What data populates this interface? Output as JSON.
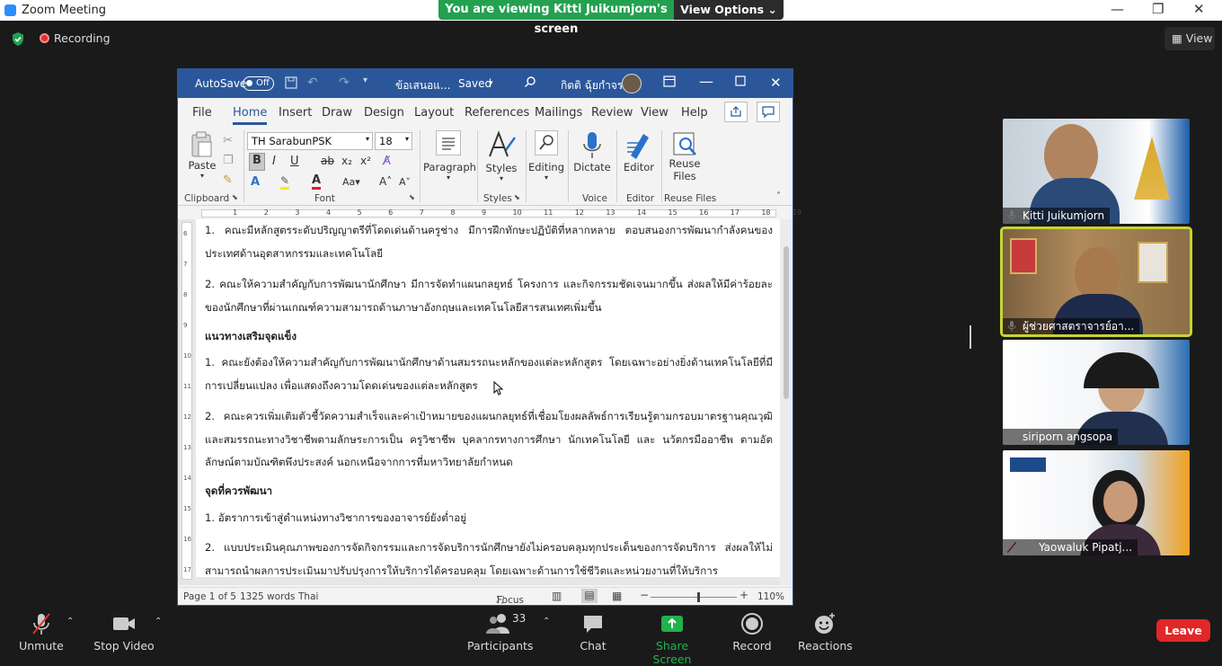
{
  "zoom": {
    "window_title": "Zoom Meeting",
    "viewing_banner": "You are viewing Kitti Juikumjorn's screen",
    "view_options_label": "View Options",
    "recording_label": "Recording",
    "view_button_label": "View",
    "window_controls": {
      "minimize": "—",
      "restore": "❐",
      "close": "✕"
    }
  },
  "word": {
    "autosave_label": "AutoSave",
    "autosave_state": "Off",
    "doc_title": "ข้อเสนอแ...",
    "saved_label": "Saved",
    "user_name": "กิตติ ฉุ้ยกำจร",
    "tabs": [
      "File",
      "Home",
      "Insert",
      "Draw",
      "Design",
      "Layout",
      "References",
      "Mailings",
      "Review",
      "View",
      "Help"
    ],
    "ribbon": {
      "paste_label": "Paste",
      "clipboard_label": "Clipboard",
      "font_name": "TH SarabunPSK",
      "font_size": "18",
      "font_label": "Font",
      "paragraph_label": "Paragraph",
      "styles_button": "Styles",
      "styles_label": "Styles",
      "editing_label": "Editing",
      "dictate_label": "Dictate",
      "voice_label": "Voice",
      "editor_button": "Editor",
      "editor_label": "Editor",
      "reuse_files_line1": "Reuse",
      "reuse_files_line2": "Files",
      "reuse_files_group": "Reuse Files"
    },
    "paragraphs": [
      {
        "type": "text",
        "text": "1. คณะมีหลักสูตรระดับปริญญาตรีที่โดดเด่นด้านครูช่าง มีการฝึกทักษะปฏิบัติที่หลากหลาย ตอบสนองการพัฒนากำลังคนของประเทศด้านอุตสาหกรรมและเทคโนโลยี"
      },
      {
        "type": "text",
        "text": "2. คณะให้ความสำคัญกับการพัฒนานักศึกษา มีการจัดทำแผนกลยุทธ์ โครงการ และกิจกรรมชัดเจนมากขึ้น ส่งผลให้มีค่าร้อยละของนักศึกษาที่ผ่านเกณฑ์ความสามารถด้านภาษาอังกฤษและเทคโนโลยีสารสนเทศเพิ่มขึ้น"
      },
      {
        "type": "heading",
        "text": "แนวทางเสริมจุดแข็ง"
      },
      {
        "type": "text",
        "text": "1. คณะยังต้องให้ความสำคัญกับการพัฒนานักศึกษาด้านสมรรถนะหลักของแต่ละหลักสูตร โดยเฉพาะอย่างยิ่งด้านเทคโนโลยีที่มีการเปลี่ยนแปลง เพื่อแสดงถึงความโดดเด่นของแต่ละหลักสูตร"
      },
      {
        "type": "text",
        "text": "2. คณะควรเพิ่มเติมตัวชี้วัดความสำเร็จและค่าเป้าหมายของแผนกลยุทธ์ที่เชื่อมโยงผลลัพธ์การเรียนรู้ตามกรอบมาตรฐานคุณวุฒิและสมรรถนะทางวิชาชีพตามลักษระการเป็น ครูวิชาชีพ บุคลากรทางการศึกษา นักเทคโนโลยี และ นวัตกรมืออาชีพ ตามอัตลักษณ์ตามบัณฑิตพึงประสงค์ นอกเหนือจากการที่มหาวิทยาลัยกำหนด"
      },
      {
        "type": "heading",
        "text": "จุดที่ควรพัฒนา"
      },
      {
        "type": "text",
        "text": "1. อัตราการเข้าสู่ตำแหน่งทางวิชาการของอาจารย์ยังต่ำอยู่"
      },
      {
        "type": "text",
        "text": "2. แบบประเมินคุณภาพของการจัดกิจกรรมและการจัดบริการนักศึกษายังไม่ครอบคลุมทุกประเด็นของการจัดบริการ ส่งผลให้ไม่สามารถนำผลการประเมินมาปรับปรุงการให้บริการได้ครอบคลุม โดยเฉพาะด้านการใช้ชีวิตและหน่วยงานที่ให้บริการ"
      }
    ],
    "status": {
      "page": "Page 1 of 5",
      "words": "1325 words",
      "language": "Thai",
      "focus": "Focus",
      "zoom": "110%",
      "zoom_fraction": 0.55
    },
    "ruler_ticks": [
      "1",
      "2",
      "3",
      "4",
      "5",
      "6",
      "7",
      "8",
      "9",
      "10",
      "11",
      "12",
      "13",
      "14",
      "15",
      "16",
      "17",
      "18",
      "19"
    ],
    "vruler_ticks": [
      "6",
      "7",
      "8",
      "9",
      "10",
      "11",
      "12",
      "13",
      "14",
      "15",
      "16",
      "17"
    ]
  },
  "participants": [
    {
      "name": "Kitti Juikumjorn",
      "muted": false,
      "active": false
    },
    {
      "name": "ผู้ช่วยศาสตราจารย์อา...",
      "muted": false,
      "active": true
    },
    {
      "name": "siriporn angsopa",
      "muted": false,
      "active": false
    },
    {
      "name": "Yaowaluk Pipatj...",
      "muted": true,
      "active": false
    }
  ],
  "toolbar": {
    "unmute": "Unmute",
    "stop_video": "Stop Video",
    "participants": "Participants",
    "participant_count": "33",
    "chat": "Chat",
    "share_screen": "Share Screen",
    "record": "Record",
    "reactions": "Reactions",
    "leave": "Leave"
  },
  "colors": {
    "word_blue": "#2b579a",
    "banner_green": "#23a150",
    "share_green": "#23b14d",
    "leave_red": "#e02828",
    "active_speaker": "#c8d432"
  }
}
